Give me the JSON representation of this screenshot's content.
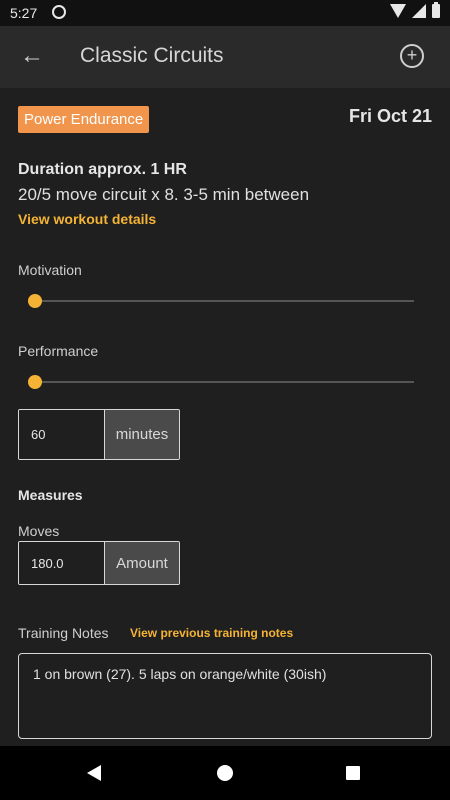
{
  "status_bar": {
    "time": "5:27"
  },
  "app_bar": {
    "title": "Classic Circuits"
  },
  "workout": {
    "category": "Power Endurance",
    "date": "Fri Oct 21",
    "duration": "Duration approx. 1 HR",
    "description": "20/5 move circuit x 8. 3-5 min between",
    "details_link": "View workout details"
  },
  "motivation": {
    "label": "Motivation",
    "value": 0
  },
  "performance": {
    "label": "Performance",
    "value": 0
  },
  "duration_input": {
    "value": "60",
    "unit": "minutes"
  },
  "measures": {
    "heading": "Measures",
    "moves_label": "Moves",
    "moves_value": "180.0",
    "moves_unit": "Amount"
  },
  "notes": {
    "label": "Training Notes",
    "link": "View previous training notes",
    "text": "1 on brown (27). 5 laps on orange/white (30ish)"
  },
  "colors": {
    "accent": "#f5b335",
    "badge": "#f0954b",
    "background": "#1f1f1f"
  }
}
